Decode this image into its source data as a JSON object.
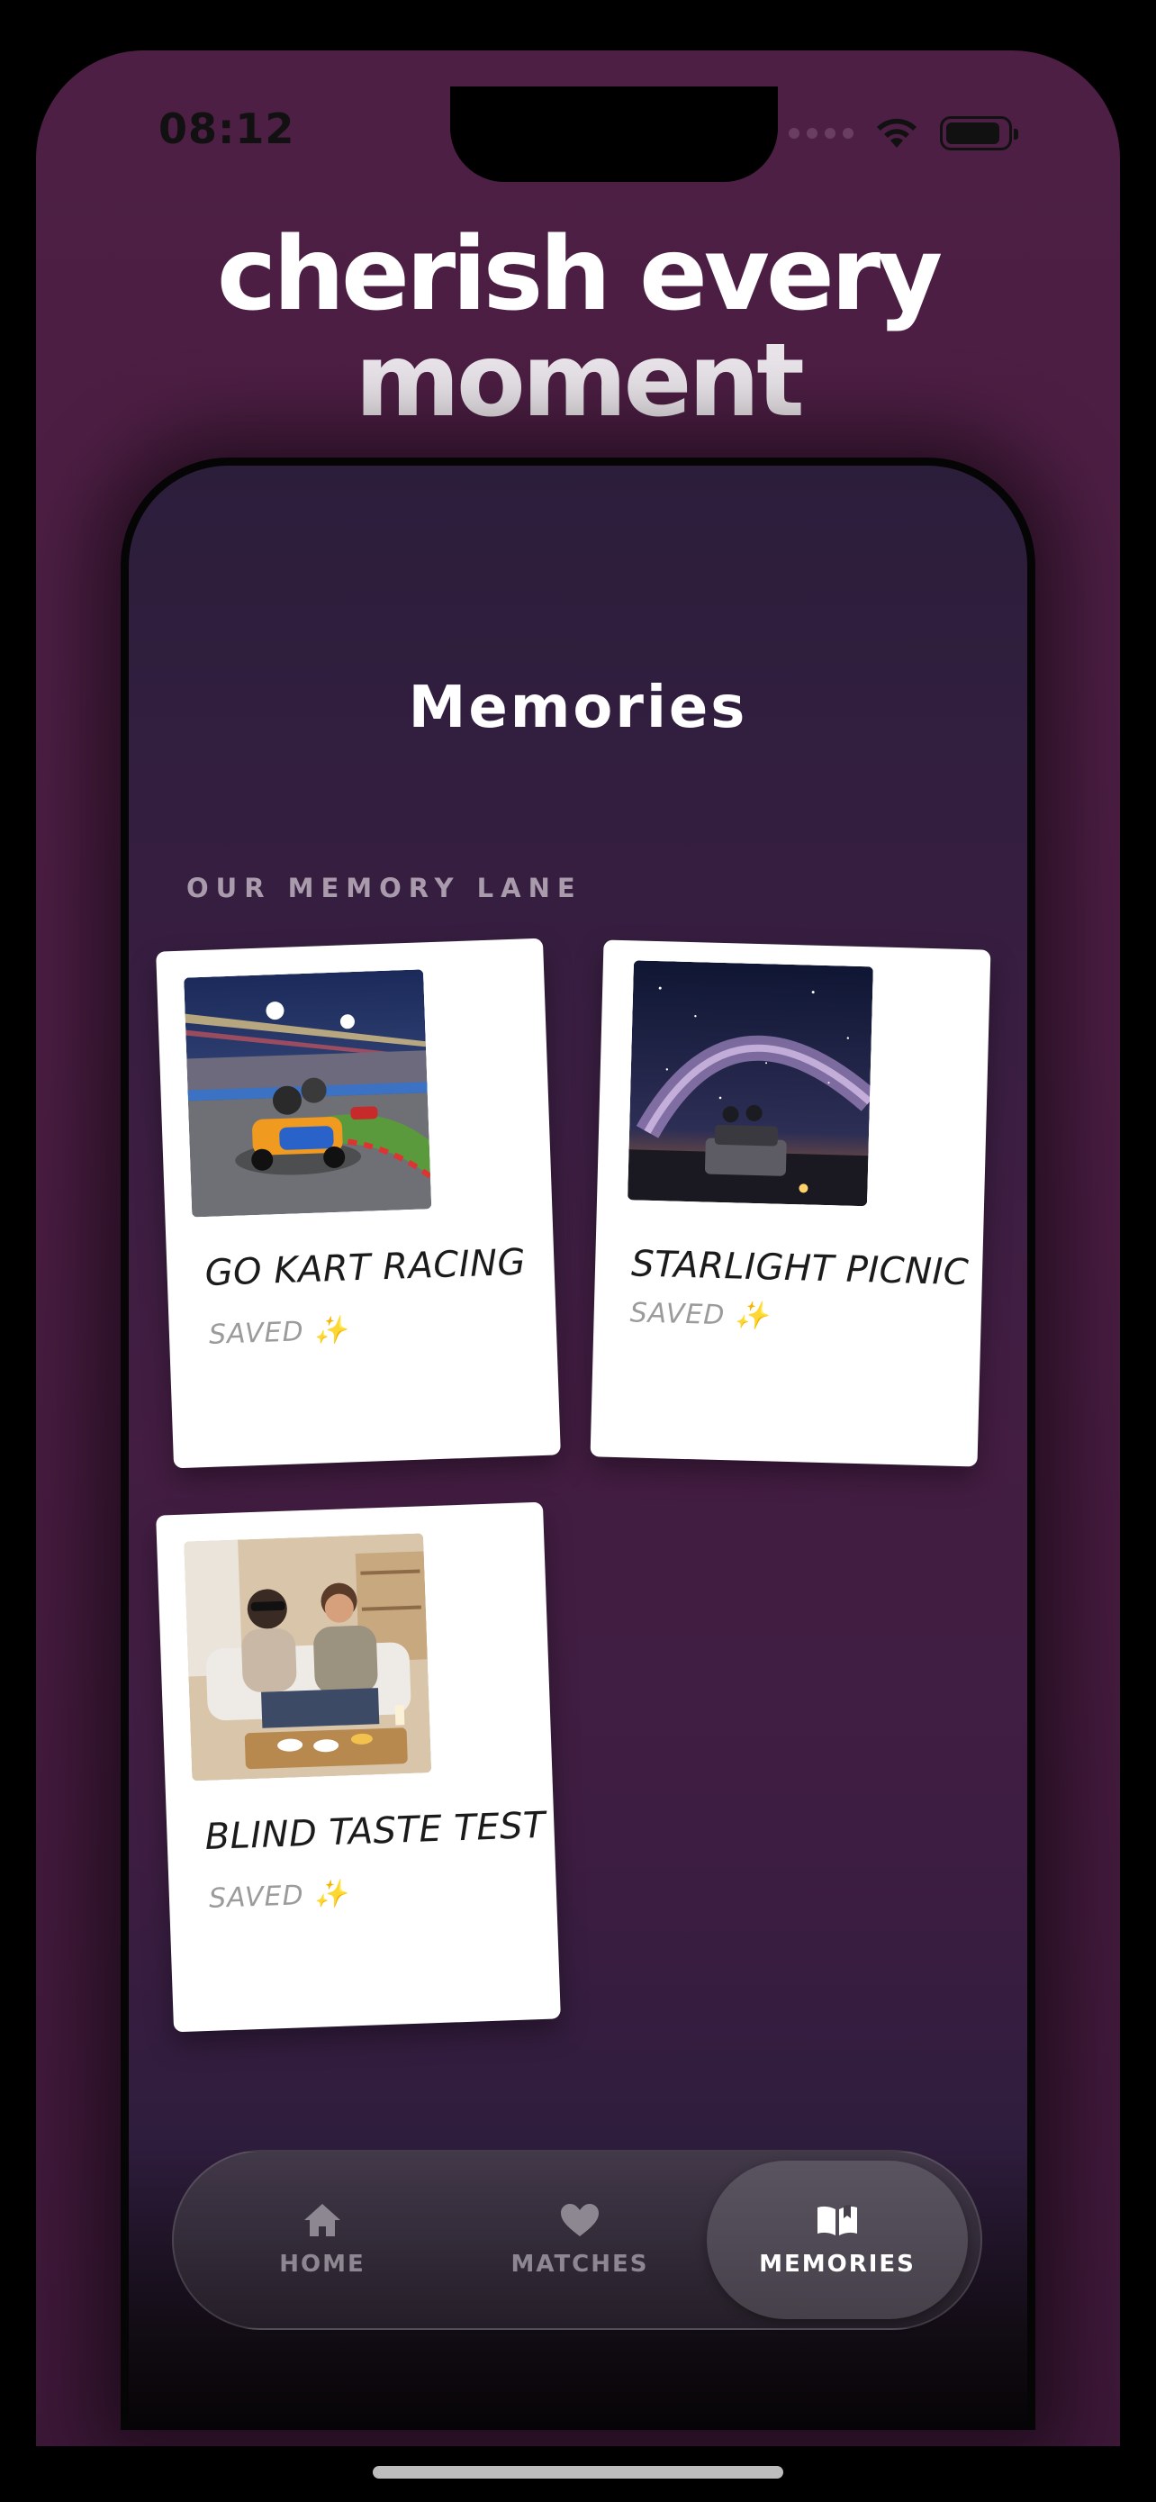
{
  "status_bar": {
    "time": "08:12",
    "battery_level": 0.9,
    "icons": [
      "signal-dots-icon",
      "wifi-icon",
      "battery-icon"
    ]
  },
  "headline": {
    "line1": "cherish every",
    "line2": "moment"
  },
  "app": {
    "title": "Memories",
    "section_label": "OUR MEMORY LANE",
    "memories": [
      {
        "caption": "GO KART RACING",
        "status": "SAVED",
        "status_icon": "✨",
        "photo": "go-kart-photo"
      },
      {
        "caption": "STARLIGHT PICNIC",
        "status": "SAVED",
        "status_icon": "✨",
        "photo": "starlight-picnic-photo"
      },
      {
        "caption": "BLIND TASTE TEST",
        "status": "SAVED",
        "status_icon": "✨",
        "photo": "blind-taste-test-photo"
      }
    ]
  },
  "tabbar": {
    "tabs": [
      {
        "label": "HOME",
        "icon": "home-icon",
        "active": false
      },
      {
        "label": "MATCHES",
        "icon": "heart-icon",
        "active": false
      },
      {
        "label": "MEMORIES",
        "icon": "open-book-icon",
        "active": true
      }
    ]
  },
  "colors": {
    "outer_background": "#4a1d42",
    "card_background": "#ffffff",
    "label_muted": "#a99aac",
    "tab_inactive": "#8d8792",
    "tab_active": "#ffffff"
  }
}
